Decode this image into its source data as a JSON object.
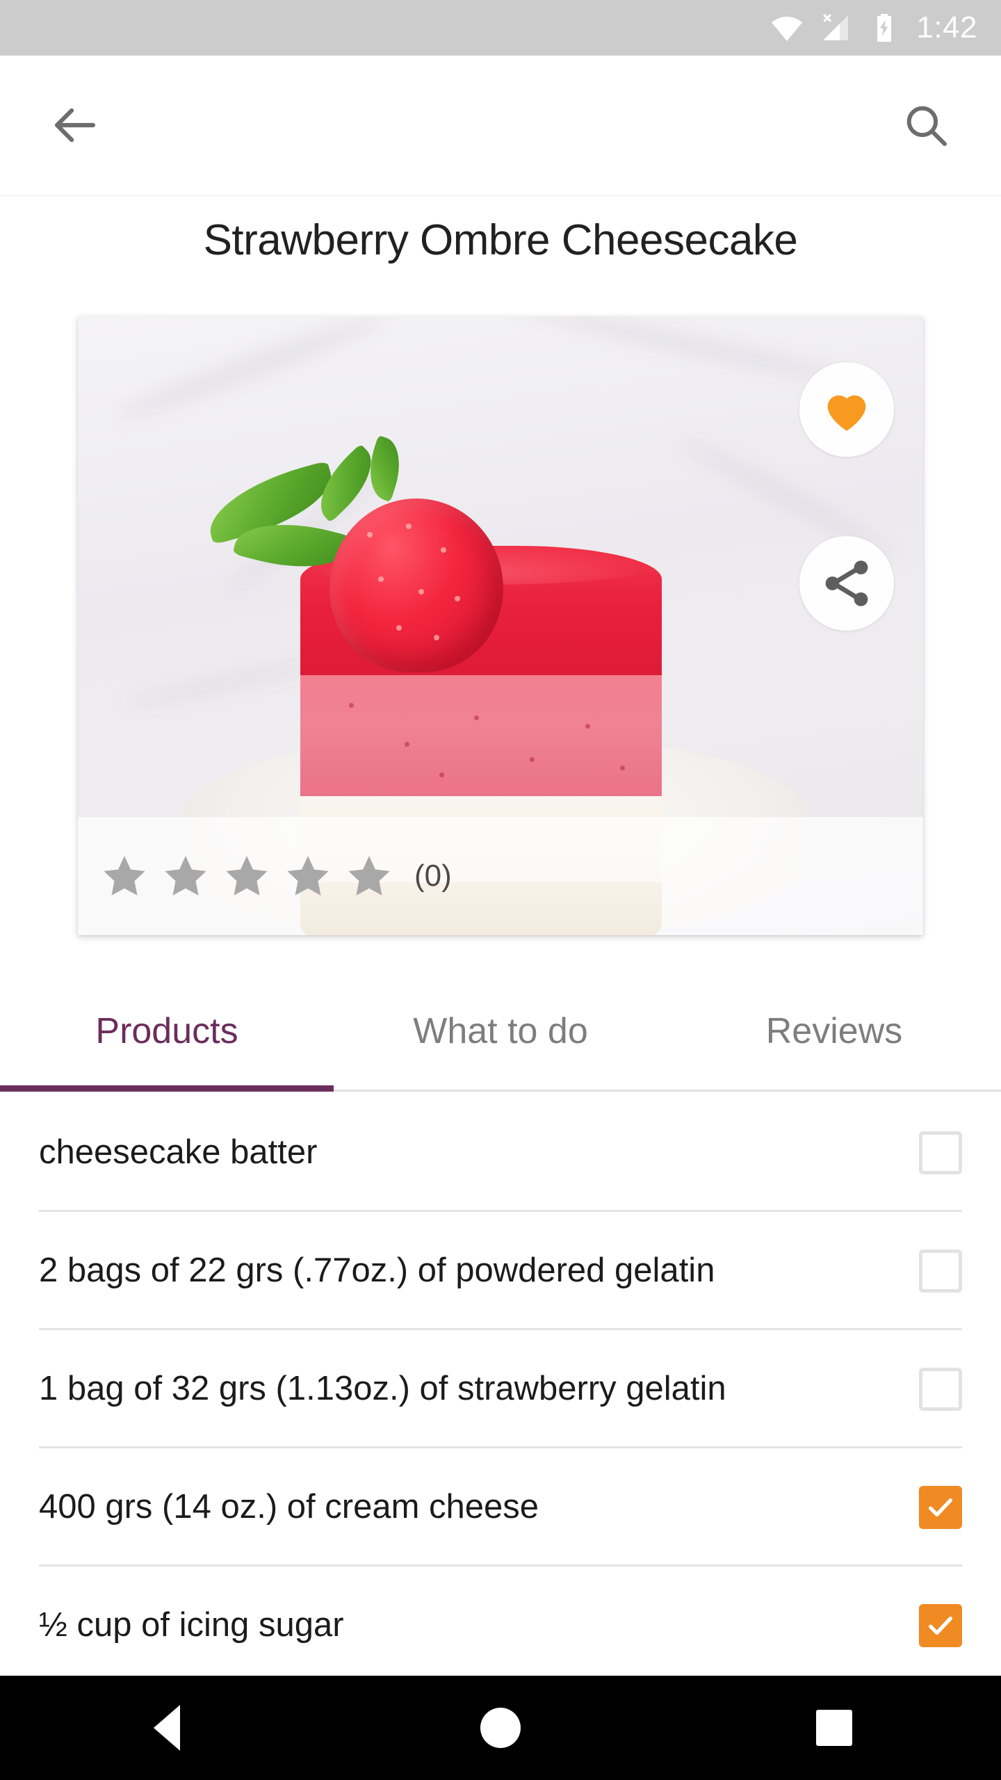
{
  "status_bar": {
    "time": "1:42",
    "icons": [
      "wifi-icon",
      "cellular-no-sim-icon",
      "battery-charging-icon"
    ],
    "background_color": "#cccccc"
  },
  "app_bar": {
    "back_label": "Back",
    "search_label": "Search",
    "icons": [
      "back-arrow-icon",
      "search-icon"
    ]
  },
  "recipe": {
    "title": "Strawberry Ombre Cheesecake",
    "favorite": {
      "label": "Favorite",
      "active": true,
      "color": "#f79a1f"
    },
    "share": {
      "label": "Share",
      "color": "#5e5e5e"
    },
    "rating": {
      "stars_total": 5,
      "stars_filled": 0,
      "count_text": "(0)",
      "star_color": "#a8a8a8"
    }
  },
  "tabs": {
    "active_index": 0,
    "active_color": "#6b2d5c",
    "inactive_color": "#7d7d7d",
    "items": [
      {
        "label": "Products"
      },
      {
        "label": "What to do"
      },
      {
        "label": "Reviews"
      }
    ]
  },
  "ingredients": {
    "checked_color": "#f08a22",
    "unchecked_border_color": "#e2e2e2",
    "items": [
      {
        "label": "cheesecake batter",
        "checked": false
      },
      {
        "label": "2 bags of 22 grs (.77oz.) of powdered gelatin",
        "checked": false
      },
      {
        "label": "1 bag of 32 grs (1.13oz.) of strawberry gelatin",
        "checked": false
      },
      {
        "label": "400 grs (14 oz.) of cream cheese",
        "checked": true
      },
      {
        "label": "½ cup of icing sugar",
        "checked": true
      }
    ]
  },
  "nav_bar": {
    "background_color": "#000000",
    "buttons": [
      {
        "name": "back",
        "icon": "triangle-back-icon"
      },
      {
        "name": "home",
        "icon": "circle-home-icon"
      },
      {
        "name": "recents",
        "icon": "square-recents-icon"
      }
    ]
  }
}
